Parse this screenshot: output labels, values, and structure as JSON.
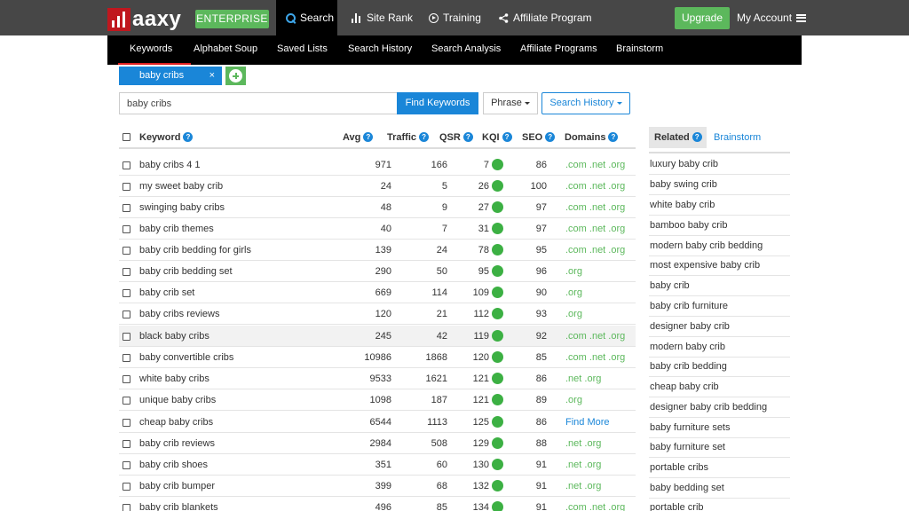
{
  "brand": {
    "logo_text": "aaxy",
    "edition": "ENTERPRISE"
  },
  "topnav": {
    "search": "Search",
    "site_rank": "Site Rank",
    "training": "Training",
    "affiliate": "Affiliate Program",
    "upgrade": "Upgrade",
    "account": "My Account"
  },
  "subnav": [
    "Keywords",
    "Alphabet Soup",
    "Saved Lists",
    "Search History",
    "Search Analysis",
    "Affiliate Programs",
    "Brainstorm"
  ],
  "tag": {
    "label": "baby cribs",
    "close": "×"
  },
  "search": {
    "value": "baby cribs",
    "find_label": "Find Keywords",
    "phrase_label": "Phrase",
    "history_label": "Search History"
  },
  "table": {
    "headers": {
      "keyword": "Keyword",
      "avg": "Avg",
      "traffic": "Traffic",
      "qsr": "QSR",
      "kqi": "KQI",
      "seo": "SEO",
      "domains": "Domains"
    },
    "help_glyph": "?",
    "kqi_color": "#3cb043",
    "rows": [
      {
        "keyword": "baby cribs 4 1",
        "avg": "971",
        "traffic": "166",
        "qsr": "7",
        "seo": "86",
        "domains": ".com .net .org"
      },
      {
        "keyword": "my sweet baby crib",
        "avg": "24",
        "traffic": "5",
        "qsr": "26",
        "seo": "100",
        "domains": ".com .net .org"
      },
      {
        "keyword": "swinging baby cribs",
        "avg": "48",
        "traffic": "9",
        "qsr": "27",
        "seo": "97",
        "domains": ".com .net .org"
      },
      {
        "keyword": "baby crib themes",
        "avg": "40",
        "traffic": "7",
        "qsr": "31",
        "seo": "97",
        "domains": ".com .net .org"
      },
      {
        "keyword": "baby crib bedding for girls",
        "avg": "139",
        "traffic": "24",
        "qsr": "78",
        "seo": "95",
        "domains": ".com .net .org"
      },
      {
        "keyword": "baby crib bedding set",
        "avg": "290",
        "traffic": "50",
        "qsr": "95",
        "seo": "96",
        "domains": ".org"
      },
      {
        "keyword": "baby crib set",
        "avg": "669",
        "traffic": "114",
        "qsr": "109",
        "seo": "90",
        "domains": ".org"
      },
      {
        "keyword": "baby cribs reviews",
        "avg": "120",
        "traffic": "21",
        "qsr": "112",
        "seo": "93",
        "domains": ".org"
      },
      {
        "keyword": "black baby cribs",
        "avg": "245",
        "traffic": "42",
        "qsr": "119",
        "seo": "92",
        "domains": ".com .net .org"
      },
      {
        "keyword": "baby convertible cribs",
        "avg": "10986",
        "traffic": "1868",
        "qsr": "120",
        "seo": "85",
        "domains": ".com .net .org"
      },
      {
        "keyword": "white baby cribs",
        "avg": "9533",
        "traffic": "1621",
        "qsr": "121",
        "seo": "86",
        "domains": ".net .org"
      },
      {
        "keyword": "unique baby cribs",
        "avg": "1098",
        "traffic": "187",
        "qsr": "121",
        "seo": "89",
        "domains": ".org"
      },
      {
        "keyword": "cheap baby cribs",
        "avg": "6544",
        "traffic": "1113",
        "qsr": "125",
        "seo": "86",
        "domains": "Find More"
      },
      {
        "keyword": "baby crib reviews",
        "avg": "2984",
        "traffic": "508",
        "qsr": "129",
        "seo": "88",
        "domains": ".net .org"
      },
      {
        "keyword": "baby crib shoes",
        "avg": "351",
        "traffic": "60",
        "qsr": "130",
        "seo": "91",
        "domains": ".net .org"
      },
      {
        "keyword": "baby crib bumper",
        "avg": "399",
        "traffic": "68",
        "qsr": "132",
        "seo": "91",
        "domains": ".net .org"
      },
      {
        "keyword": "baby crib blankets",
        "avg": "496",
        "traffic": "85",
        "qsr": "134",
        "seo": "91",
        "domains": ".com .net .org"
      }
    ]
  },
  "related": {
    "tab_label": "Related",
    "brainstorm_label": "Brainstorm",
    "items": [
      "luxury baby crib",
      "baby swing crib",
      "white baby crib",
      "bamboo baby crib",
      "modern baby crib bedding",
      "most expensive baby crib",
      "baby crib",
      "baby crib furniture",
      "designer baby crib",
      "modern baby crib",
      "baby crib bedding",
      "cheap baby crib",
      "designer baby crib bedding",
      "baby furniture sets",
      "baby furniture set",
      "portable cribs",
      "baby bedding set",
      "portable crib"
    ]
  }
}
